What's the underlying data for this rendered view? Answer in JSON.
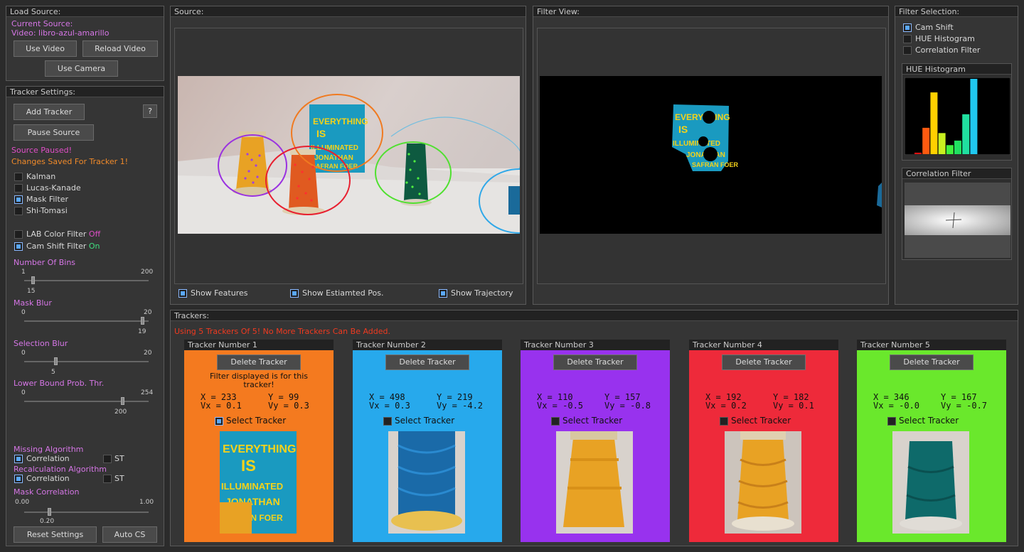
{
  "load_source": {
    "title": "Load Source:",
    "current_source_label": "Current Source:",
    "video_label": "Video: libro-azul-amarillo",
    "use_video": "Use Video",
    "reload_video": "Reload Video",
    "use_camera": "Use Camera"
  },
  "tracker_settings": {
    "title": "Tracker Settings:",
    "add_tracker": "Add Tracker",
    "help": "?",
    "pause_source": "Pause Source",
    "status_paused": "Source Paused!",
    "status_saved": "Changes Saved For Tracker 1!",
    "options": [
      {
        "label": "Kalman",
        "checked": false
      },
      {
        "label": "Lucas-Kanade",
        "checked": false
      },
      {
        "label": "Mask Filter",
        "checked": true
      },
      {
        "label": "Shi-Tomasi",
        "checked": false
      }
    ],
    "lab_filter": {
      "label": "LAB Color Filter",
      "state": "Off",
      "checked": false
    },
    "cam_shift_filter": {
      "label": "Cam Shift Filter",
      "state": "On",
      "checked": true
    },
    "sliders": [
      {
        "label": "Number Of Bins",
        "min": "1",
        "max": "200",
        "value": "15",
        "fraction": 0.07
      },
      {
        "label": "Mask Blur",
        "min": "0",
        "max": "20",
        "value": "19",
        "fraction": 0.95
      },
      {
        "label": "Selection Blur",
        "min": "0",
        "max": "20",
        "value": "5",
        "fraction": 0.25
      },
      {
        "label": "Lower Bound Prob. Thr.",
        "min": "0",
        "max": "254",
        "value": "200",
        "fraction": 0.79
      }
    ],
    "missing_algorithm": {
      "label": "Missing Algorithm",
      "correlation": "Correlation",
      "st": "ST",
      "correlation_checked": true,
      "st_checked": false
    },
    "recalc_algorithm": {
      "label": "Recalculation Algorithm",
      "correlation": "Correlation",
      "st": "ST",
      "correlation_checked": true,
      "st_checked": false
    },
    "mask_correlation": {
      "label": "Mask Correlation",
      "min": "0.00",
      "max": "1.00",
      "value": "0.20",
      "fraction": 0.2
    },
    "reset_settings": "Reset Settings",
    "auto_cs": "Auto CS"
  },
  "source": {
    "title": "Source:",
    "show_features": "Show Features",
    "show_estimated": "Show Estiamted Pos.",
    "show_trajectory": "Show Trajectory"
  },
  "filter_view": {
    "title": "Filter View:"
  },
  "filter_selection": {
    "title": "Filter Selection:",
    "options": [
      {
        "label": "Cam Shift",
        "checked": true
      },
      {
        "label": "HUE Histogram",
        "checked": false
      },
      {
        "label": "Correlation Filter",
        "checked": false
      }
    ],
    "hue_title": "HUE Histogram",
    "correlation_title": "Correlation Filter",
    "hue_bars": [
      {
        "value": 0.02,
        "color": "#e01010"
      },
      {
        "value": 0.35,
        "color": "#ff5a10"
      },
      {
        "value": 0.82,
        "color": "#ffd000"
      },
      {
        "value": 0.28,
        "color": "#c8f020"
      },
      {
        "value": 0.12,
        "color": "#40f040"
      },
      {
        "value": 0.18,
        "color": "#20e060"
      },
      {
        "value": 0.53,
        "color": "#20e0a0"
      },
      {
        "value": 1.0,
        "color": "#20c8f0"
      }
    ]
  },
  "trackers": {
    "title": "Trackers:",
    "warning": "Using 5 Trackers Of 5! No More Trackers Can Be Added.",
    "delete_label": "Delete Tracker",
    "select_label": "Select Tracker",
    "filter_note": "Filter displayed is for this tracker!",
    "items": [
      {
        "title": "Tracker Number 1",
        "x": "X = 233",
        "y": "Y = 99",
        "vx": "Vx = 0.1",
        "vy": "Vy = 0.3",
        "color": "#f47a1f",
        "selected": true
      },
      {
        "title": "Tracker Number 2",
        "x": "X = 498",
        "y": "Y = 219",
        "vx": "Vx = 0.3",
        "vy": "Vy = -4.2",
        "color": "#27a9ec",
        "selected": false
      },
      {
        "title": "Tracker Number 3",
        "x": "X = 110",
        "y": "Y = 157",
        "vx": "Vx = -0.5",
        "vy": "Vy = -0.8",
        "color": "#9832ee",
        "selected": false
      },
      {
        "title": "Tracker Number 4",
        "x": "X = 192",
        "y": "Y = 182",
        "vx": "Vx = 0.2",
        "vy": "Vy = 0.1",
        "color": "#ee2a3a",
        "selected": false
      },
      {
        "title": "Tracker Number 5",
        "x": "X = 346",
        "y": "Y = 167",
        "vx": "Vx = -0.0",
        "vy": "Vy = -0.7",
        "color": "#6ae82c",
        "selected": false
      }
    ]
  },
  "book": {
    "line1": "EVERYTHING",
    "line2": "IS",
    "line3": "ILLUMINATED",
    "line4": "JONATHAN",
    "line5": "SAFRAN FOER"
  }
}
